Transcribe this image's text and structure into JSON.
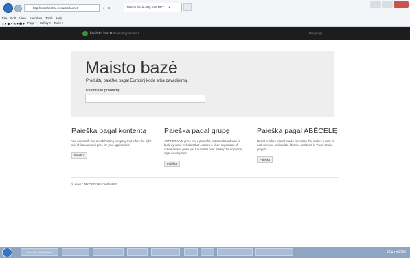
{
  "browser": {
    "address": "http://localhost:a...resursbrku.net",
    "address_tools": "⌕ ▾ C",
    "tab_title": "Maisto bazė - My ASP.NET ... ×",
    "menu": [
      "File",
      "Edit",
      "View",
      "Favorites",
      "Tools",
      "Help"
    ],
    "commands": [
      "Page ▾",
      "Safety ▾",
      "Tools ▾"
    ]
  },
  "navbar": {
    "brand": "Maisto bazė",
    "dropdown": "Produktų paieška ▾",
    "login": "Prisijungti"
  },
  "jumbotron": {
    "title": "Maisto bazė",
    "lead": "Produktų paieška pagal Europinį kodą arba pavadinimą.",
    "select_label": "Pasirinkite produktą:"
  },
  "columns": [
    {
      "heading": "Paieška pagal kontentą",
      "text": "You can easily find a web hosting company that offers the right mix of features and price for your applications.",
      "button": "Paieška"
    },
    {
      "heading": "Paieška pagal grupę",
      "text": "ASP.NET MVC gives you a powerful, patterns-based way to build dynamic websites that enables a clean separation of concerns and gives you full control over markup for enjoyable, agile development.",
      "button": "Paieška"
    },
    {
      "heading": "Paieška pagal ABĖCĖLĘ",
      "text": "NuGet is a free Visual Studio extension that makes it easy to add, remove, and update libraries and tools in Visual Studio projects.",
      "button": "Paieška"
    }
  ],
  "footer": "© 2017 - My ASP.NET Application",
  "taskbar": {
    "items": [
      "tomcat - MyDiploma",
      "",
      "",
      "",
      "",
      "",
      "",
      "",
      "",
      ""
    ],
    "tray": "LT  ▴ ▪ ◂  10:53"
  }
}
